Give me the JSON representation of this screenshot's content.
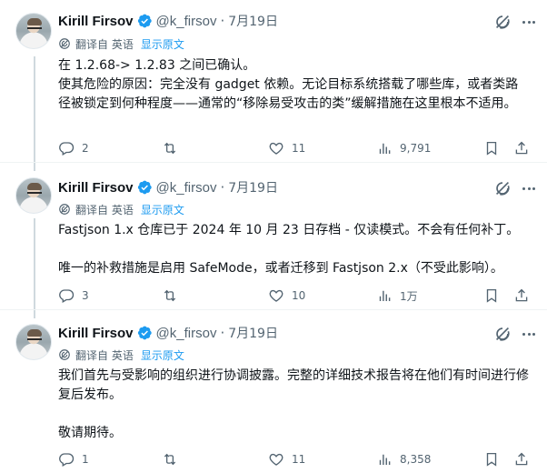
{
  "author": {
    "name": "Kirill Firsov",
    "handle": "@k_firsov",
    "date": "7月19日"
  },
  "translation": {
    "label": "翻译自 英语",
    "show_original": "显示原文"
  },
  "tweets": [
    {
      "text": "在 1.2.68-> 1.2.83 之间已确认。\n使其危险的原因：完全没有 gadget 依赖。无论目标系统搭载了哪些库，或者类路径被锁定到何种程度——通常的“移除易受攻击的类”缓解措施在这里根本不适用。",
      "replies": "2",
      "reposts": "",
      "likes": "11",
      "views": "9,791"
    },
    {
      "text": "Fastjson 1.x 仓库已于 2024 年 10 月 23 日存档 - 仅读模式。不会有任何补丁。\n\n唯一的补救措施是启用 SafeMode，或者迁移到 Fastjson 2.x（不受此影响）。",
      "replies": "3",
      "reposts": "",
      "likes": "10",
      "views": "1万"
    },
    {
      "text": "我们首先与受影响的组织进行协调披露。完整的详细技术报告将在他们有时间进行修复后发布。\n\n敬请期待。",
      "replies": "1",
      "reposts": "",
      "likes": "11",
      "views": "8,358"
    }
  ],
  "icons": {
    "verified": "verified-badge-icon",
    "grok": "grok-icon",
    "more": "more-icon",
    "translate": "translate-icon",
    "reply": "reply-icon",
    "repost": "repost-icon",
    "like": "like-icon",
    "views": "views-icon",
    "bookmark": "bookmark-icon",
    "share": "share-icon"
  },
  "colors": {
    "accent": "#1d9bf0",
    "muted": "#536471",
    "text": "#0f1419",
    "thread_line": "#cfd9de"
  }
}
